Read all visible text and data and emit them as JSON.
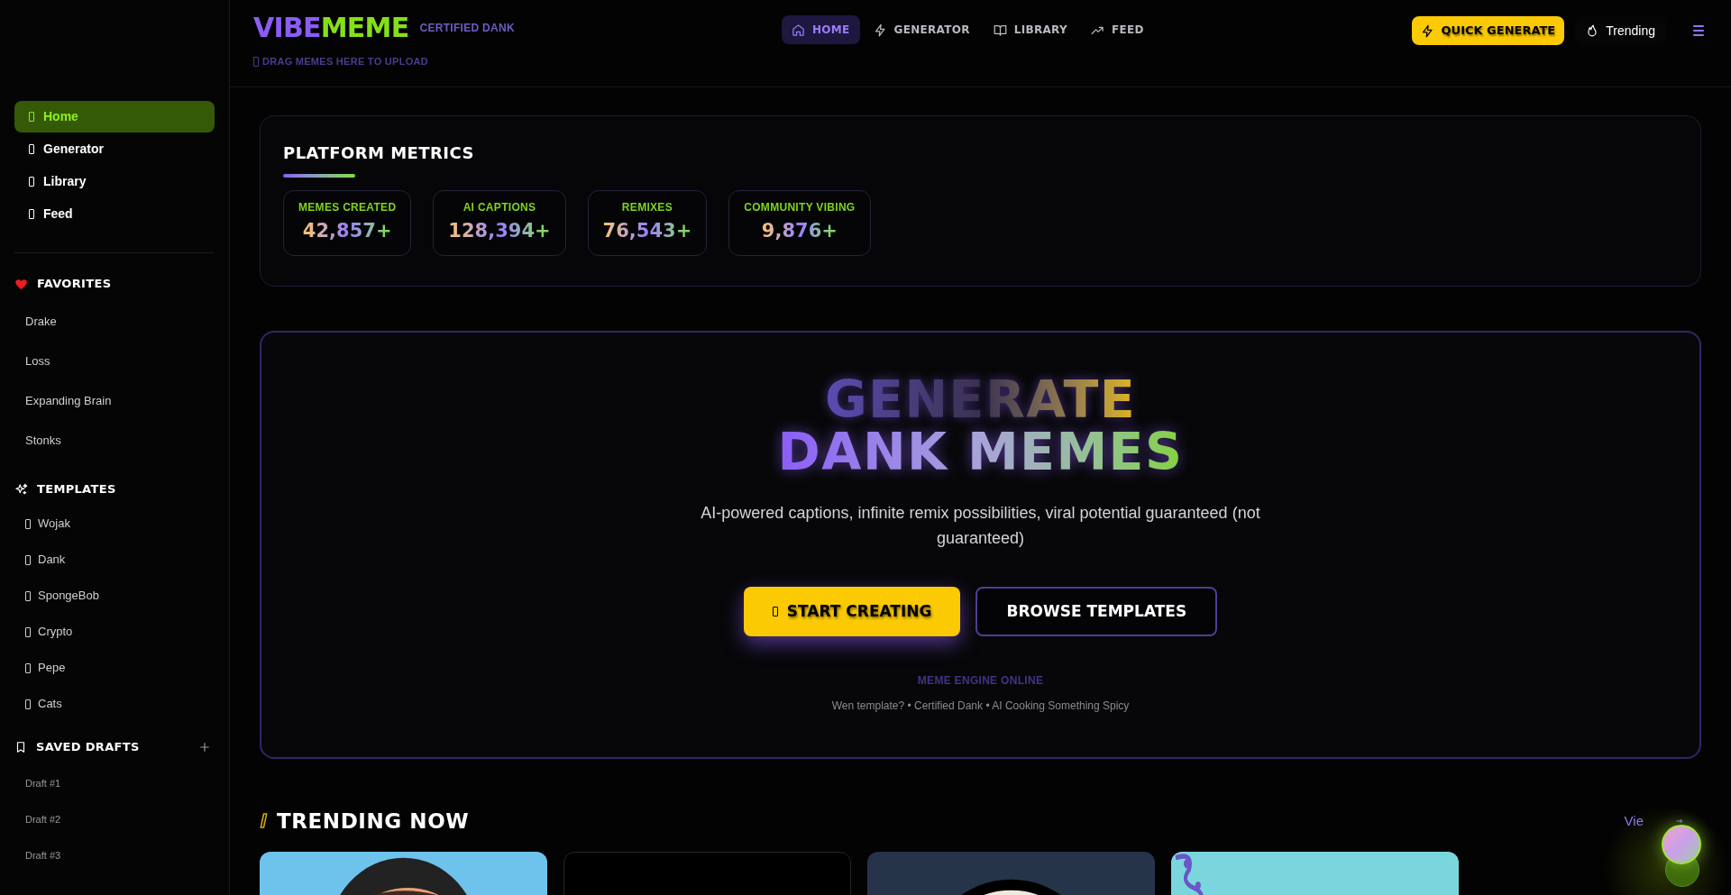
{
  "header": {
    "logo_parts": [
      "VIBE",
      "MEME"
    ],
    "tagline": "CERTIFIED DANK",
    "upload_hint": "DRAG MEMES HERE TO UPLOAD",
    "nav": [
      {
        "label": "HOME",
        "selected": true
      },
      {
        "label": "GENERATOR",
        "selected": false
      },
      {
        "label": "LIBRARY",
        "selected": false
      },
      {
        "label": "FEED",
        "selected": false
      }
    ],
    "quick_generate": "QUICK GENERATE",
    "trending": "Trending"
  },
  "sidebar": {
    "nav": [
      {
        "label": "Home",
        "selected": true
      },
      {
        "label": "Generator",
        "selected": false
      },
      {
        "label": "Library",
        "selected": false
      },
      {
        "label": "Feed",
        "selected": false
      }
    ],
    "favorites": {
      "title": "FAVORITES",
      "items": [
        "Drake",
        "Loss",
        "Expanding Brain",
        "Stonks"
      ]
    },
    "templates": {
      "title": "TEMPLATES",
      "items": [
        "Wojak",
        "Dank",
        "SpongeBob",
        "Crypto",
        "Pepe",
        "Cats"
      ]
    },
    "drafts": {
      "title": "SAVED DRAFTS",
      "items": [
        "Draft #1",
        "Draft #2",
        "Draft #3"
      ]
    }
  },
  "metrics": {
    "title": "PLATFORM METRICS",
    "items": [
      {
        "label": "MEMES CREATED",
        "value": "42,857+"
      },
      {
        "label": "AI CAPTIONS",
        "value": "128,394+"
      },
      {
        "label": "REMIXES",
        "value": "76,543+"
      },
      {
        "label": "COMMUNITY VIBING",
        "value": "9,876+"
      }
    ]
  },
  "hero": {
    "title_lines": [
      "GENERATE",
      "DANK MEMES"
    ],
    "subtitle": "AI-powered captions, infinite remix possibilities, viral potential guaranteed (not guaranteed)",
    "primary_button": "START CREATING",
    "secondary_button": "BROWSE TEMPLATES",
    "status": "MEME ENGINE ONLINE",
    "footnote": "Wen template? • Certified Dank • AI Cooking Something Spicy"
  },
  "trending": {
    "title": "TRENDING NOW",
    "link": "Vie",
    "cards": [
      {
        "kind": "head-blue"
      },
      {
        "kind": "dark"
      },
      {
        "kind": "head-slate"
      },
      {
        "kind": "squiggle-teal"
      }
    ]
  }
}
